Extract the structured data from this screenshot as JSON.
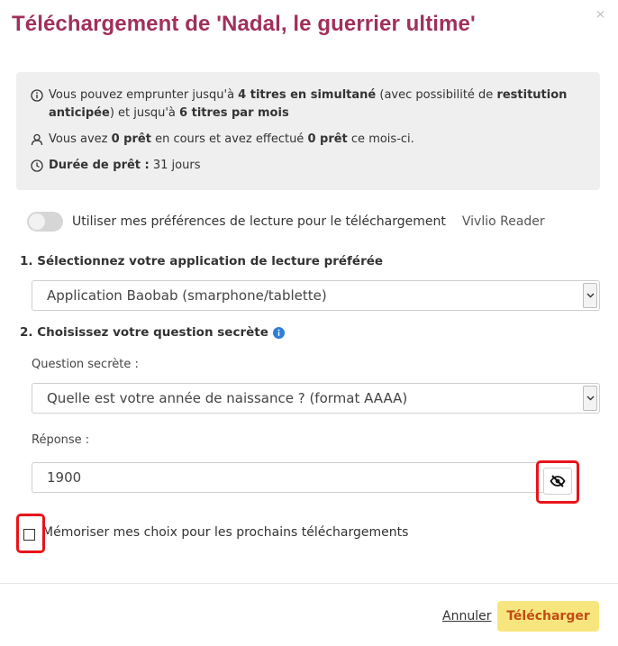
{
  "dialog": {
    "title": "Téléchargement de 'Nadal, le guerrier ultime'",
    "close_label": "×"
  },
  "info": {
    "loan_line": {
      "t1": "Vous pouvez emprunter jusqu'à ",
      "b1": "4 titres en simultané",
      "t2": " (avec possibilité de ",
      "b2": "restitution anticipée",
      "t3": ") et jusqu'à ",
      "b3": "6 titres par mois"
    },
    "current_line": {
      "t1": "Vous avez ",
      "b1": "0 prêt",
      "t2": " en cours et avez effectué ",
      "b2": "0 prêt",
      "t3": " ce mois-ci."
    },
    "duration_line": {
      "label": "Durée de prêt :",
      "value": " 31 jours"
    }
  },
  "preferences": {
    "toggle_label": "Utiliser mes préférences de lecture pour le téléchargement",
    "app_name": "Vivlio Reader",
    "toggle_on": false
  },
  "section1": {
    "title": "1. Sélectionnez votre application de lecture préférée",
    "selected_app": "Application Baobab (smarphone/tablette)"
  },
  "section2": {
    "title": "2. Choisissez votre question secrète",
    "question_label": "Question secrète :",
    "selected_question": "Quelle est votre année de naissance ? (format AAAA)",
    "answer_label": "Réponse :",
    "answer_value": "1900"
  },
  "remember": {
    "label": "Mémoriser mes choix pour les prochains téléchargements",
    "checked": false
  },
  "footer": {
    "cancel_label": "Annuler",
    "download_label": "Télécharger"
  },
  "colors": {
    "title": "#a0305a",
    "download_bg": "#f7e67e",
    "download_text": "#c24b13",
    "highlight_border": "#e8141a",
    "info_icon": "#2f7fd6"
  }
}
